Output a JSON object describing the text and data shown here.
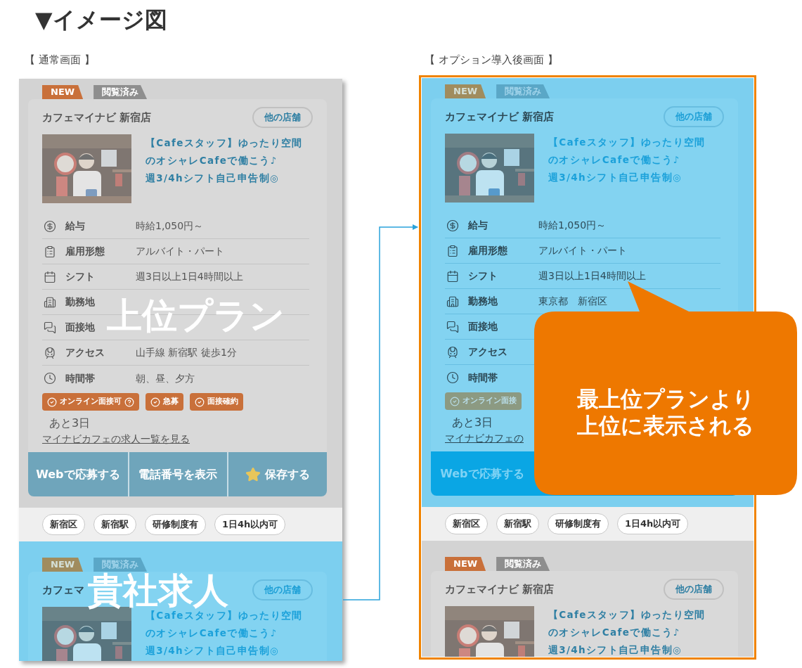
{
  "heading": "▼イメージ図",
  "panels": [
    {
      "label": "【 通常画面 】",
      "highlighted": false,
      "sections": [
        {
          "kind": "listing",
          "highlighted": false,
          "overlay_label": "上位プラン",
          "card": {
            "tabs": [
              {
                "kind": "new",
                "label": "NEW"
              },
              {
                "kind": "viewed",
                "label": "閲覧済み"
              }
            ],
            "store": "カフェマイナビ 新宿店",
            "other_stores": "他の店舗",
            "title": [
              "【Cafeスタッフ】ゆったり空間",
              "のオシャレCafeで働こう♪",
              "週3/4hシフト自己申告制◎"
            ],
            "rows": [
              {
                "kind": "salary",
                "label": "給与",
                "value": "時給1,050円～"
              },
              {
                "kind": "employment",
                "label": "雇用形態",
                "value": "アルバイト・パート"
              },
              {
                "kind": "shift",
                "label": "シフト",
                "value": "週3日以上1日4時間以上"
              },
              {
                "kind": "workplace",
                "label": "勤務地"
              },
              {
                "kind": "interview",
                "label": "面接地"
              },
              {
                "kind": "access",
                "label": "アクセス",
                "value": "山手線 新宿駅 徒歩1分"
              },
              {
                "kind": "hours",
                "label": "時間帯",
                "value": "朝、昼、夕方"
              }
            ],
            "badges": [
              {
                "label": "オンライン面接可",
                "help": true
              },
              {
                "label": "急募",
                "help": false
              },
              {
                "label": "面接確約",
                "help": false
              }
            ],
            "deadline": "あと3日",
            "link": "マイナビカフェの求人一覧を見る",
            "actions": [
              {
                "kind": "plain",
                "label": "Webで応募する"
              },
              {
                "kind": "plain",
                "label": "電話番号を表示"
              },
              {
                "kind": "star",
                "label": "保存する"
              }
            ]
          }
        },
        {
          "kind": "tags",
          "tags": [
            "新宿区",
            "新宿駅",
            "研修制度有",
            "1日4h以内可"
          ]
        },
        {
          "kind": "listing",
          "highlighted": true,
          "overlay_label": "貴社求人",
          "card": {
            "tabs": [
              {
                "kind": "new",
                "label": "NEW"
              },
              {
                "kind": "viewed",
                "label": "閲覧済み"
              }
            ],
            "store": "カフェマ",
            "other_stores": "他の店舗",
            "title": [
              "【Cafeスタッフ】ゆったり空間",
              "のオシャレCafeで働こう♪",
              "週3/4hシフト自己申告制◎"
            ]
          }
        }
      ]
    },
    {
      "label": "【 オプション導入後画面 】",
      "highlighted": true,
      "callout": [
        "最上位プランより",
        "上位に表示される"
      ],
      "sections": [
        {
          "kind": "listing",
          "highlighted": true,
          "card": {
            "tabs": [
              {
                "kind": "new",
                "label": "NEW"
              },
              {
                "kind": "viewed",
                "label": "閲覧済み"
              }
            ],
            "store": "カフェマイナビ 新宿店",
            "other_stores": "他の店舗",
            "title": [
              "【Cafeスタッフ】ゆったり空間",
              "のオシャレCafeで働こう♪",
              "週3/4hシフト自己申告制◎"
            ],
            "rows": [
              {
                "kind": "salary",
                "label": "給与",
                "value": "時給1,050円～"
              },
              {
                "kind": "employment",
                "label": "雇用形態",
                "value": "アルバイト・パート"
              },
              {
                "kind": "shift",
                "label": "シフト",
                "value": "週3日以上1日4時間以上"
              },
              {
                "kind": "workplace",
                "label": "勤務地",
                "value": "東京都　新宿区"
              },
              {
                "kind": "interview",
                "label": "面接地"
              },
              {
                "kind": "access",
                "label": "アクセス"
              },
              {
                "kind": "hours",
                "label": "時間帯"
              }
            ],
            "badges": [
              {
                "label": "オンライン面接",
                "help": false
              }
            ],
            "deadline": "あと3日",
            "link": "マイナビカフェの",
            "actions": [
              {
                "kind": "plain",
                "label": "Webで応募する"
              }
            ]
          }
        },
        {
          "kind": "tags",
          "tags": [
            "新宿区",
            "新宿駅",
            "研修制度有",
            "1日4h以内可"
          ]
        },
        {
          "kind": "listing",
          "highlighted": false,
          "card": {
            "tabs": [
              {
                "kind": "new",
                "label": "NEW"
              },
              {
                "kind": "viewed",
                "label": "閲覧済み"
              }
            ],
            "store": "カフェマイナビ 新宿店",
            "other_stores": "他の店舗",
            "title": [
              "【Cafeスタッフ】ゆったり空間",
              "のオシャレCafeで働こう♪",
              "週3/4hシフト自己申告制◎"
            ]
          }
        }
      ]
    }
  ]
}
